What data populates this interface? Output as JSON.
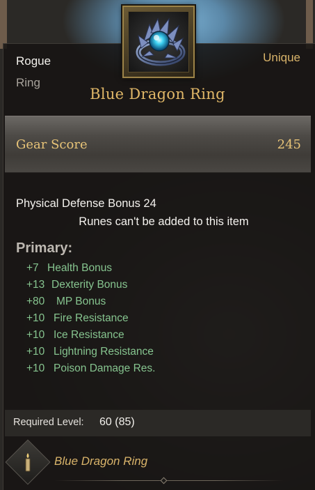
{
  "item": {
    "class": "Rogue",
    "type": "Ring",
    "rarity": "Unique",
    "name": "Blue Dragon Ring",
    "icon": "blue-dragon-ring-icon"
  },
  "gear_score": {
    "label": "Gear Score",
    "value": "245"
  },
  "base": {
    "physical_defense": "Physical Defense Bonus 24",
    "runes_note": "Runes can't be added to this item"
  },
  "primary": {
    "heading": "Primary:",
    "stats": [
      {
        "value": "+7",
        "name": "Health Bonus"
      },
      {
        "value": "+13",
        "name": "Dexterity Bonus"
      },
      {
        "value": "+80",
        "name": "MP Bonus"
      },
      {
        "value": "+10",
        "name": "Fire Resistance"
      },
      {
        "value": "+10",
        "name": "Ice Resistance"
      },
      {
        "value": "+10",
        "name": "Lightning Resistance"
      },
      {
        "value": "+10",
        "name": "Poison Damage Res."
      }
    ]
  },
  "requirement": {
    "label": "Required Level:",
    "value": "60 (85)"
  },
  "footer": {
    "icon": "candle-icon",
    "name": "Blue Dragon Ring"
  },
  "colors": {
    "rarity": "#d9b46a",
    "item_name": "#e1b868",
    "stat_green": "#86c48f",
    "panel_bg": "#161413"
  }
}
